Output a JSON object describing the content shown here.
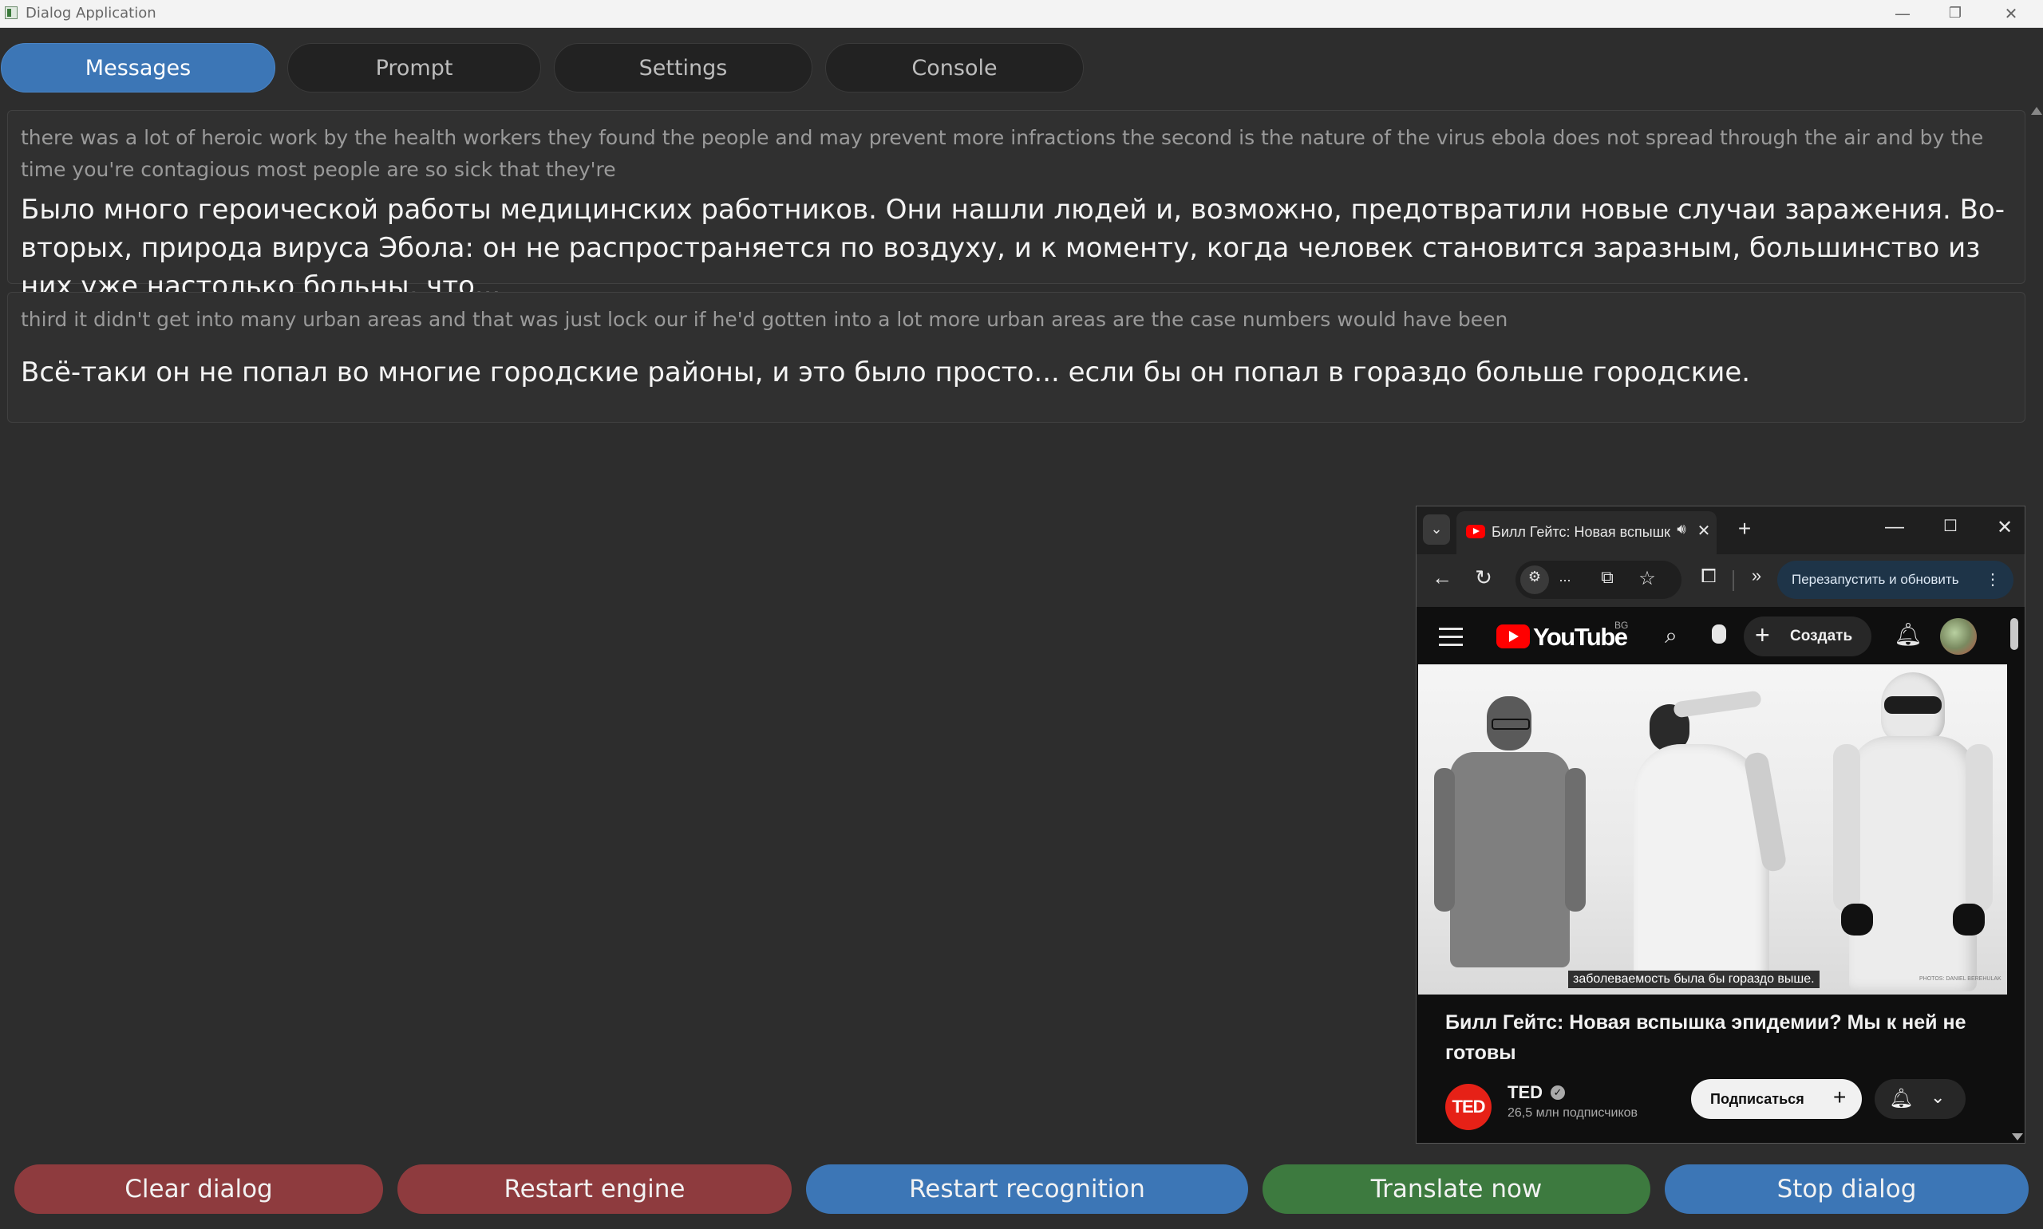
{
  "window": {
    "title": "Dialog Application",
    "controls": {
      "minimize": "—",
      "restore": "❐",
      "close": "✕"
    }
  },
  "tabs": [
    {
      "label": "Messages",
      "active": true
    },
    {
      "label": "Prompt",
      "active": false
    },
    {
      "label": "Settings",
      "active": false
    },
    {
      "label": "Console",
      "active": false
    }
  ],
  "messages": [
    {
      "source": "there was a lot of heroic work by the health workers they found the people and may prevent more infractions the second is the nature of the virus ebola does not spread through the air and by the time you're contagious most people are so sick that they're",
      "translation": "Было много героической работы медицинских работников. Они нашли людей и, возможно, предотвратили новые случаи заражения. Во-вторых, природа вируса Эбола: он не распространяется по воздуху, и к моменту, когда человек становится заразным, большинство из них уже настолько больны, что..."
    },
    {
      "source": "third it didn't get into many urban areas and that was just lock our if he'd gotten into a lot more urban areas are the case numbers would have been",
      "translation": "Всё-таки он не попал во многие городские районы, и это было просто... если бы он попал в гораздо больше городские."
    }
  ],
  "buttons": {
    "clear": "Clear dialog",
    "restart_engine": "Restart engine",
    "restart_recognition": "Restart recognition",
    "translate": "Translate now",
    "stop": "Stop dialog"
  },
  "colors": {
    "red_button": "#8e3b3e",
    "blue_button": "#3c76b6",
    "green_button": "#3d7a3f",
    "background": "#2d2d2d"
  },
  "browser": {
    "tab_title": "Билл Гейтс: Новая вспышк",
    "relaunch_label": "Перезапустить и обновить",
    "omnibox_ellipsis": "...",
    "youtube": {
      "logo_text": "YouTube",
      "region": "BG",
      "create_label": "Создать",
      "subtitle": "заболеваемость была бы гораздо выше.",
      "photo_credit": "PHOTOS: DANIEL BEREHULAK",
      "video_title": "Билл Гейтс: Новая вспышка эпидемии? Мы к ней не готовы",
      "channel_name": "TED",
      "channel_logo": "TED",
      "subscribers": "26,5 млн подписчиков",
      "subscribe_label": "Подписаться"
    },
    "icons": [
      "tab-search-icon",
      "youtube-favicon",
      "speaker-icon",
      "close-tab-icon",
      "new-tab-icon",
      "minimize-icon",
      "maximize-icon",
      "close-icon",
      "back-icon",
      "reload-icon",
      "site-info-icon",
      "cast-icon",
      "star-icon",
      "extensions-icon",
      "more-tools-icon",
      "kebab-icon",
      "hamburger-icon",
      "search-icon",
      "mic-icon",
      "plus-icon",
      "bell-icon",
      "avatar",
      "verified-icon"
    ]
  }
}
